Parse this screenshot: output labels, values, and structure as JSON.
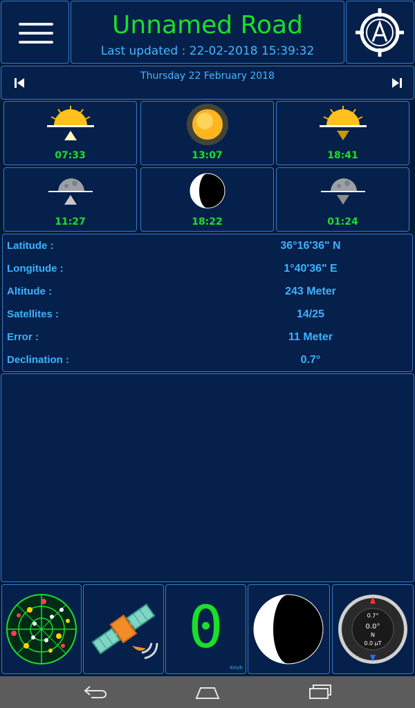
{
  "header": {
    "title": "Unnamed Road",
    "last_updated": "Last updated : 22-02-2018 15:39:32",
    "menu_icon": "hamburger-menu-icon",
    "compass_icon": "compass-icon"
  },
  "date_bar": {
    "date": "Thursday 22 February 2018",
    "prev_icon": "skip-previous-icon",
    "next_icon": "skip-next-icon"
  },
  "sun": {
    "sunrise": "07:33",
    "noon": "13:07",
    "sunset": "18:41"
  },
  "moon": {
    "moonrise": "11:27",
    "transit": "18:22",
    "moonset": "01:24"
  },
  "info": [
    {
      "label": "Latitude :",
      "value": "36°16'36\" N"
    },
    {
      "label": "Longitude :",
      "value": "1°40'36\" E"
    },
    {
      "label": "Altitude :",
      "value": "243 Meter"
    },
    {
      "label": "Satellites :",
      "value": "14/25"
    },
    {
      "label": "Error :",
      "value": "11 Meter"
    },
    {
      "label": "Declination :",
      "value": "0.7°"
    }
  ],
  "bottom_tiles": {
    "speed_value": "0",
    "speed_unit": "Km/h",
    "compass_readout_1": "0.7°",
    "compass_readout_2": "0.0°",
    "compass_readout_3": "N",
    "compass_readout_4": "0.0 μT"
  },
  "colors": {
    "background": "#001a3a",
    "panel": "#05204a",
    "border": "#3a7bd0",
    "title_green": "#19e02a",
    "text_blue": "#3db2ff"
  }
}
